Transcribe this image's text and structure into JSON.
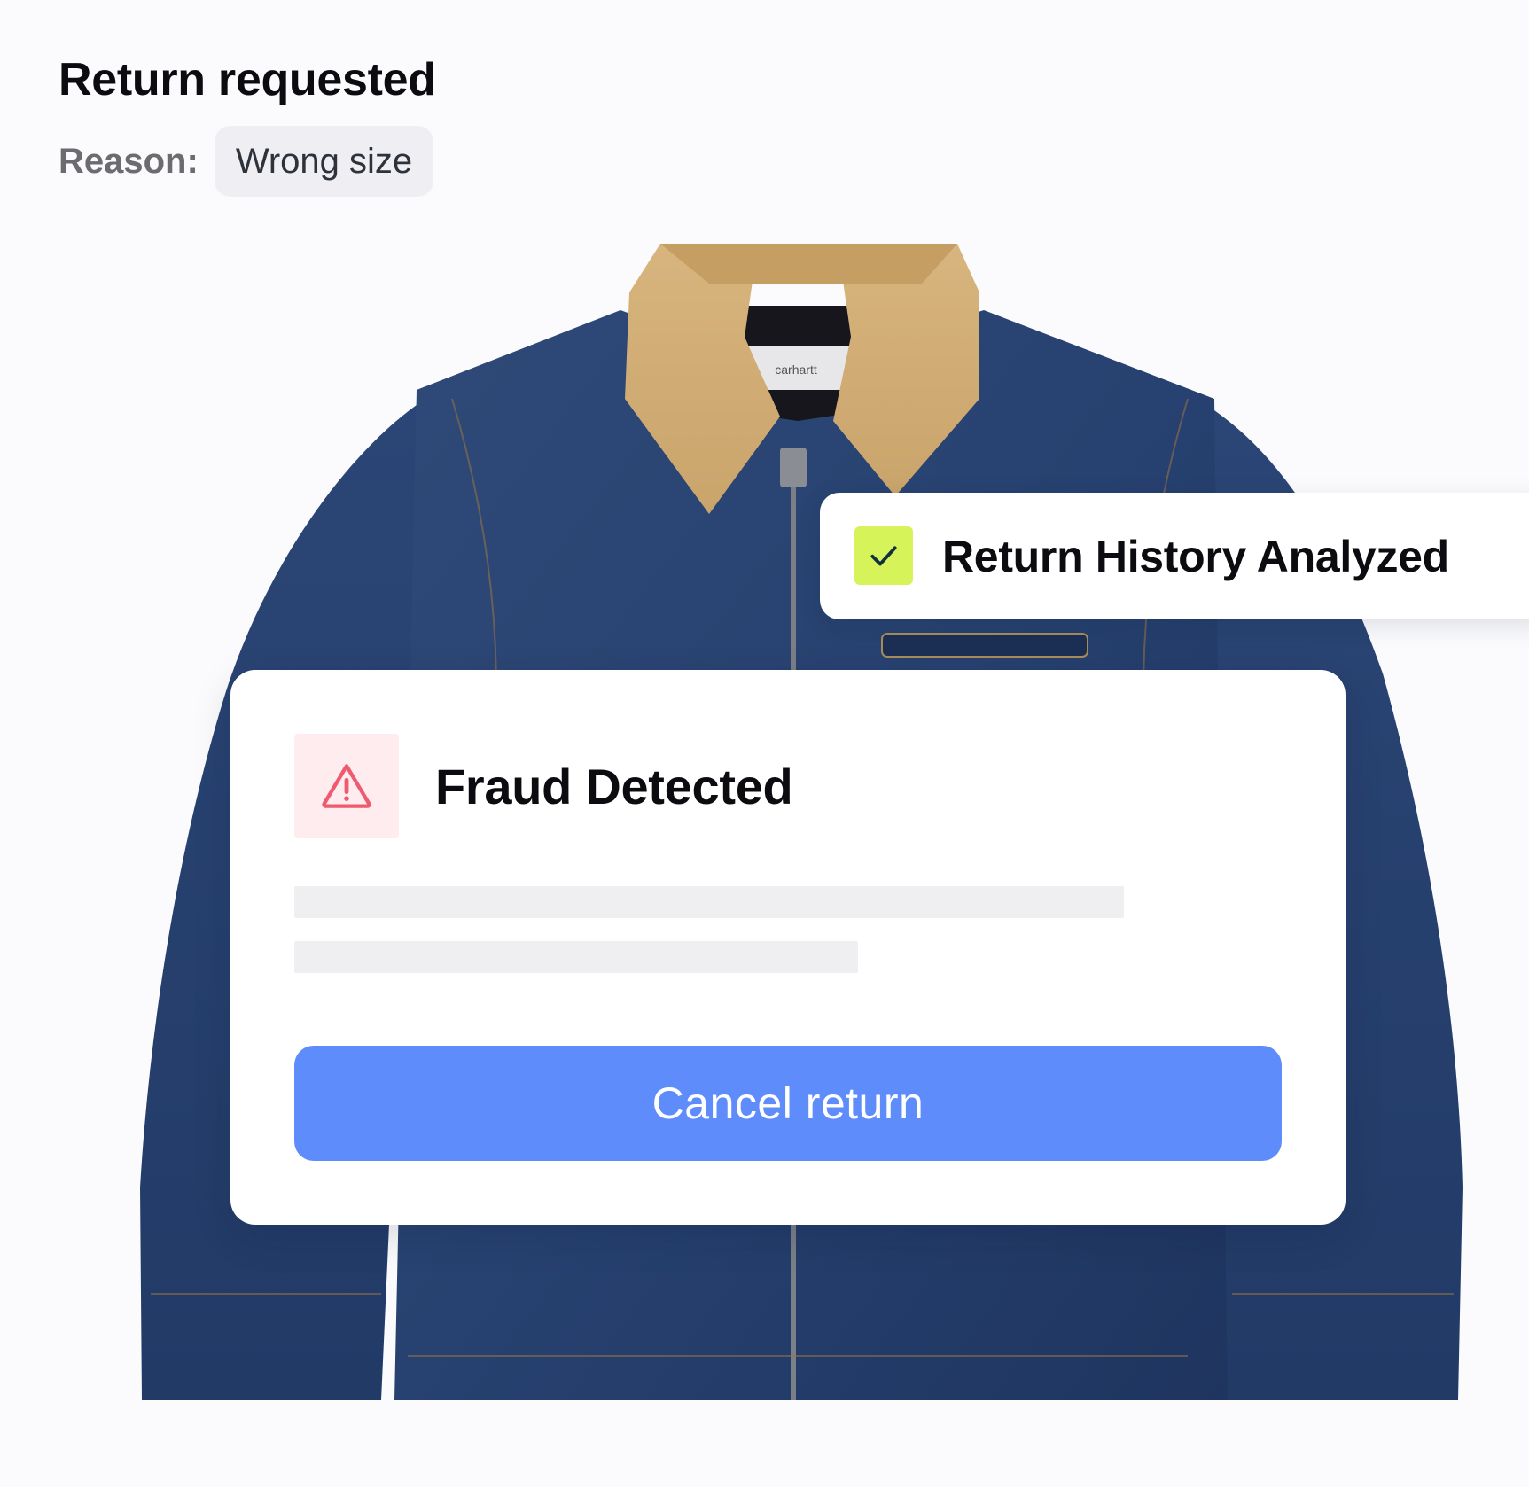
{
  "header": {
    "title": "Return requested",
    "reason_label": "Reason:",
    "reason_value": "Wrong size"
  },
  "product_image": {
    "label_brand": "carhartt"
  },
  "history_status": {
    "icon": "check-icon",
    "text": "Return History Analyzed",
    "accent_color": "#d6f35a"
  },
  "fraud_alert": {
    "icon": "warning-triangle-icon",
    "title": "Fraud Detected",
    "icon_color": "#ef5a6f",
    "icon_bg": "#ffecef",
    "action_label": "Cancel return",
    "action_color": "#5f8cfb"
  }
}
